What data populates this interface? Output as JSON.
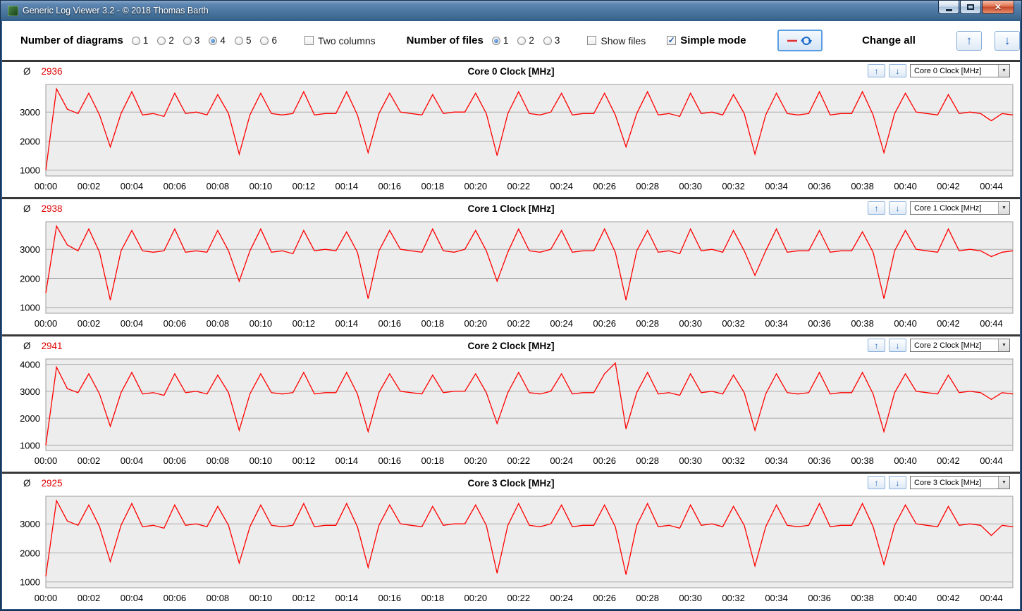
{
  "window": {
    "title": "Generic Log Viewer 3.2 - © 2018 Thomas Barth"
  },
  "icons": {
    "arrow_up": "↑",
    "arrow_down": "↓",
    "dropdown_arrow": "▼",
    "check": "✓",
    "close": "✕",
    "average_symbol": "Ø"
  },
  "colors": {
    "line_red": "#ff0000",
    "average_red": "#e00000",
    "accent_blue": "#1f66c0",
    "plot_background": "#ededed"
  },
  "toolbar": {
    "number_of_diagrams_label": "Number of diagrams",
    "diagram_options": [
      "1",
      "2",
      "3",
      "4",
      "5",
      "6"
    ],
    "diagrams_selected": "4",
    "two_columns_label": "Two columns",
    "two_columns_checked": false,
    "number_of_files_label": "Number of files",
    "file_options": [
      "1",
      "2",
      "3"
    ],
    "files_selected": "1",
    "show_files_label": "Show files",
    "show_files_checked": false,
    "simple_mode_label": "Simple mode",
    "simple_mode_checked": true,
    "change_all_label": "Change all"
  },
  "charts": [
    {
      "average": "2936",
      "title": "Core 0 Clock [MHz]",
      "dropdown_value": "Core 0 Clock [MHz]"
    },
    {
      "average": "2938",
      "title": "Core 1 Clock [MHz]",
      "dropdown_value": "Core 1 Clock [MHz]"
    },
    {
      "average": "2941",
      "title": "Core 2 Clock [MHz]",
      "dropdown_value": "Core 2 Clock [MHz]"
    },
    {
      "average": "2925",
      "title": "Core 3 Clock [MHz]",
      "dropdown_value": "Core 3 Clock [MHz]"
    }
  ],
  "chart_data": {
    "type": "line",
    "line_color": "#ff0000",
    "grid": "horizontal",
    "sample_interval_seconds": 30,
    "x_range_seconds": [
      0,
      2700
    ],
    "x_tick_seconds": [
      0,
      120,
      240,
      360,
      480,
      600,
      720,
      840,
      960,
      1080,
      1200,
      1320,
      1440,
      1560,
      1680,
      1800,
      1920,
      2040,
      2160,
      2280,
      2400,
      2520,
      2640
    ],
    "x_tick_labels": [
      "00:00",
      "00:02",
      "00:04",
      "00:06",
      "00:08",
      "00:10",
      "00:12",
      "00:14",
      "00:16",
      "00:18",
      "00:20",
      "00:22",
      "00:24",
      "00:26",
      "00:28",
      "00:30",
      "00:32",
      "00:34",
      "00:36",
      "00:38",
      "00:40",
      "00:42",
      "00:44"
    ],
    "series": [
      {
        "name": "Core 0 Clock [MHz]",
        "average": 2936,
        "y_ticks": [
          1000,
          2000,
          3000
        ],
        "y_range": [
          800,
          3950
        ],
        "values": [
          1000,
          3800,
          3100,
          2950,
          3650,
          2900,
          1800,
          2950,
          3700,
          2900,
          2950,
          2850,
          3650,
          2950,
          3000,
          2900,
          3600,
          2950,
          1550,
          2900,
          3650,
          2950,
          2900,
          2950,
          3700,
          2900,
          2950,
          2950,
          3700,
          2900,
          1600,
          2950,
          3650,
          3000,
          2950,
          2900,
          3600,
          2950,
          3000,
          3000,
          3650,
          2950,
          1500,
          2950,
          3700,
          2950,
          2900,
          3000,
          3650,
          2900,
          2950,
          2950,
          3650,
          2900,
          1800,
          2950,
          3700,
          2900,
          2950,
          2850,
          3650,
          2950,
          3000,
          2900,
          3600,
          2950,
          1550,
          2900,
          3650,
          2950,
          2900,
          2950,
          3700,
          2900,
          2950,
          2950,
          3700,
          2900,
          1600,
          2950,
          3650,
          3000,
          2950,
          2900,
          3600,
          2950,
          3000,
          2950,
          2700,
          2950,
          2900
        ]
      },
      {
        "name": "Core 1 Clock [MHz]",
        "average": 2938,
        "y_ticks": [
          1000,
          2000,
          3000
        ],
        "y_range": [
          800,
          3950
        ],
        "values": [
          1500,
          3800,
          3150,
          2950,
          3700,
          2900,
          1250,
          2950,
          3650,
          2950,
          2900,
          2950,
          3700,
          2900,
          2950,
          2900,
          3650,
          2950,
          1900,
          2950,
          3700,
          2900,
          2950,
          2850,
          3650,
          2950,
          3000,
          2950,
          3600,
          2900,
          1300,
          2950,
          3650,
          3000,
          2950,
          2900,
          3700,
          2950,
          2900,
          3000,
          3650,
          2950,
          1900,
          2900,
          3700,
          2950,
          2900,
          3000,
          3650,
          2900,
          2950,
          2950,
          3700,
          2900,
          1250,
          2950,
          3650,
          2900,
          2950,
          2850,
          3700,
          2950,
          3000,
          2900,
          3650,
          2950,
          2100,
          2950,
          3700,
          2900,
          2950,
          2950,
          3650,
          2900,
          2950,
          2950,
          3600,
          2900,
          1300,
          2950,
          3650,
          3000,
          2950,
          2900,
          3700,
          2950,
          3000,
          2950,
          2750,
          2900,
          2950
        ]
      },
      {
        "name": "Core 2 Clock [MHz]",
        "average": 2941,
        "y_ticks": [
          1000,
          2000,
          3000,
          4000
        ],
        "y_range": [
          800,
          4200
        ],
        "values": [
          1000,
          3900,
          3100,
          2950,
          3650,
          2900,
          1700,
          2950,
          3700,
          2900,
          2950,
          2850,
          3650,
          2950,
          3000,
          2900,
          3600,
          2950,
          1550,
          2900,
          3650,
          2950,
          2900,
          2950,
          3700,
          2900,
          2950,
          2950,
          3700,
          2900,
          1500,
          2950,
          3650,
          3000,
          2950,
          2900,
          3600,
          2950,
          3000,
          3000,
          3650,
          2950,
          1800,
          2950,
          3700,
          2950,
          2900,
          3000,
          3650,
          2900,
          2950,
          2950,
          3650,
          4050,
          1600,
          2950,
          3700,
          2900,
          2950,
          2850,
          3650,
          2950,
          3000,
          2900,
          3600,
          2950,
          1550,
          2900,
          3650,
          2950,
          2900,
          2950,
          3700,
          2900,
          2950,
          2950,
          3700,
          2900,
          1500,
          2950,
          3650,
          3000,
          2950,
          2900,
          3600,
          2950,
          3000,
          2950,
          2700,
          2950,
          2900
        ]
      },
      {
        "name": "Core 3 Clock [MHz]",
        "average": 2925,
        "y_ticks": [
          1000,
          2000,
          3000
        ],
        "y_range": [
          800,
          3950
        ],
        "values": [
          1200,
          3800,
          3100,
          2950,
          3650,
          2900,
          1700,
          2950,
          3700,
          2900,
          2950,
          2850,
          3650,
          2950,
          3000,
          2900,
          3600,
          2950,
          1650,
          2900,
          3650,
          2950,
          2900,
          2950,
          3700,
          2900,
          2950,
          2950,
          3700,
          2900,
          1500,
          2950,
          3650,
          3000,
          2950,
          2900,
          3600,
          2950,
          3000,
          3000,
          3650,
          2950,
          1300,
          2950,
          3700,
          2950,
          2900,
          3000,
          3650,
          2900,
          2950,
          2950,
          3650,
          2900,
          1250,
          2950,
          3700,
          2900,
          2950,
          2850,
          3650,
          2950,
          3000,
          2900,
          3600,
          2950,
          1550,
          2900,
          3650,
          2950,
          2900,
          2950,
          3700,
          2900,
          2950,
          2950,
          3700,
          2900,
          1600,
          2950,
          3650,
          3000,
          2950,
          2900,
          3600,
          2950,
          3000,
          2950,
          2600,
          2950,
          2900
        ]
      }
    ]
  }
}
